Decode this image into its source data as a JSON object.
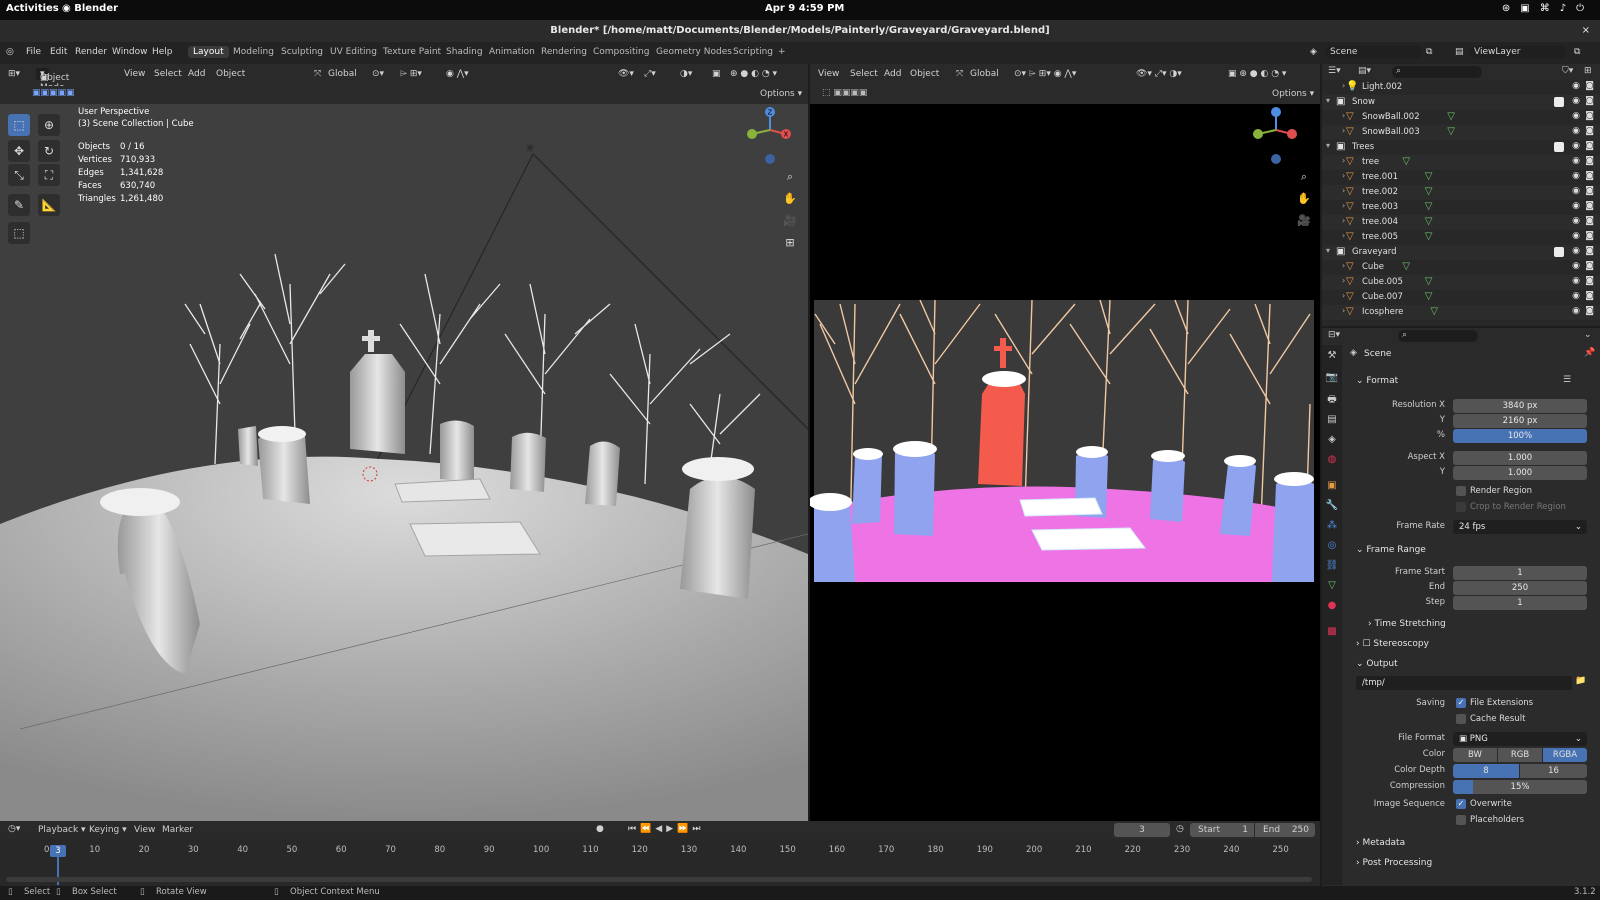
{
  "system": {
    "activities": "Activities",
    "app": "Blender",
    "clock": "Apr 9  4:59 PM",
    "tray_icons": [
      "steam-icon",
      "clipboard-icon",
      "network-icon",
      "volume-icon",
      "power-icon"
    ]
  },
  "window": {
    "title": "Blender* [/home/matt/Documents/Blender/Models/Painterly/Graveyard/Graveyard.blend]",
    "close": "×"
  },
  "menu": {
    "items": [
      "File",
      "Edit",
      "Render",
      "Window",
      "Help"
    ],
    "workspaces": [
      "Layout",
      "Modeling",
      "Sculpting",
      "UV Editing",
      "Texture Paint",
      "Shading",
      "Animation",
      "Rendering",
      "Compositing",
      "Geometry Nodes",
      "Scripting",
      "+"
    ],
    "active_workspace": "Layout",
    "scene": "Scene",
    "view_layer": "ViewLayer"
  },
  "left_viewport": {
    "mode": "Object Mode",
    "menus": [
      "View",
      "Select",
      "Add",
      "Object"
    ],
    "orientation": "Global",
    "options": "Options",
    "perspective": "User Perspective",
    "collection": "(3) Scene Collection | Cube",
    "stats": [
      {
        "label": "Objects",
        "value": "0 / 16"
      },
      {
        "label": "Vertices",
        "value": "710,933"
      },
      {
        "label": "Edges",
        "value": "1,341,628"
      },
      {
        "label": "Faces",
        "value": "630,740"
      },
      {
        "label": "Triangles",
        "value": "1,261,480"
      }
    ]
  },
  "right_viewport": {
    "menus": [
      "View",
      "Select",
      "Add",
      "Object"
    ],
    "orientation": "Global",
    "options": "Options"
  },
  "outliner": {
    "rows": [
      {
        "name": "Light.002",
        "depth": 2,
        "type": "light"
      },
      {
        "name": "Snow",
        "depth": 1,
        "type": "collection"
      },
      {
        "name": "SnowBall.002",
        "depth": 2,
        "type": "mesh"
      },
      {
        "name": "SnowBall.003",
        "depth": 2,
        "type": "mesh"
      },
      {
        "name": "Trees",
        "depth": 1,
        "type": "collection"
      },
      {
        "name": "tree",
        "depth": 2,
        "type": "mesh"
      },
      {
        "name": "tree.001",
        "depth": 2,
        "type": "mesh"
      },
      {
        "name": "tree.002",
        "depth": 2,
        "type": "mesh"
      },
      {
        "name": "tree.003",
        "depth": 2,
        "type": "mesh"
      },
      {
        "name": "tree.004",
        "depth": 2,
        "type": "mesh"
      },
      {
        "name": "tree.005",
        "depth": 2,
        "type": "mesh"
      },
      {
        "name": "Graveyard",
        "depth": 1,
        "type": "collection"
      },
      {
        "name": "Cube",
        "depth": 2,
        "type": "mesh"
      },
      {
        "name": "Cube.005",
        "depth": 2,
        "type": "mesh"
      },
      {
        "name": "Cube.007",
        "depth": 2,
        "type": "mesh"
      },
      {
        "name": "Icosphere",
        "depth": 2,
        "type": "mesh"
      }
    ]
  },
  "properties": {
    "context": "Scene",
    "format": {
      "title": "Format",
      "res_x_label": "Resolution X",
      "res_x": "3840 px",
      "res_y_label": "Y",
      "res_y": "2160 px",
      "pct_label": "%",
      "pct": "100%",
      "aspect_x_label": "Aspect X",
      "aspect_x": "1.000",
      "aspect_y_label": "Y",
      "aspect_y": "1.000",
      "render_region": "Render Region",
      "crop_region": "Crop to Render Region",
      "frame_rate_label": "Frame Rate",
      "frame_rate": "24 fps"
    },
    "frame_range": {
      "title": "Frame Range",
      "start_label": "Frame Start",
      "start": "1",
      "end_label": "End",
      "end": "250",
      "step_label": "Step",
      "step": "1"
    },
    "time_stretching": "Time Stretching",
    "stereoscopy": "Stereoscopy",
    "output": {
      "title": "Output",
      "path": "/tmp/",
      "saving_label": "Saving",
      "file_extensions": "File Extensions",
      "cache_result": "Cache Result",
      "file_format_label": "File Format",
      "file_format": "PNG",
      "color_label": "Color",
      "color_options": [
        "BW",
        "RGB",
        "RGBA"
      ],
      "depth_label": "Color Depth",
      "depth_options": [
        "8",
        "16"
      ],
      "compression_label": "Compression",
      "compression": "15%",
      "image_seq_label": "Image Sequence",
      "overwrite": "Overwrite",
      "placeholders": "Placeholders"
    },
    "metadata": "Metadata",
    "post_processing": "Post Processing"
  },
  "timeline": {
    "menus": [
      "Playback",
      "Keying",
      "View",
      "Marker"
    ],
    "current_frame": "3",
    "start_label": "Start",
    "start": "1",
    "end_label": "End",
    "end": "250",
    "ticks": [
      "0",
      "10",
      "20",
      "30",
      "40",
      "50",
      "60",
      "70",
      "80",
      "90",
      "100",
      "110",
      "120",
      "130",
      "140",
      "150",
      "160",
      "170",
      "180",
      "190",
      "200",
      "210",
      "220",
      "230",
      "240",
      "250"
    ]
  },
  "status": {
    "select": "Select",
    "box_select": "Box Select",
    "rotate": "Rotate View",
    "context_menu": "Object Context Menu",
    "version": "3.1.2"
  }
}
